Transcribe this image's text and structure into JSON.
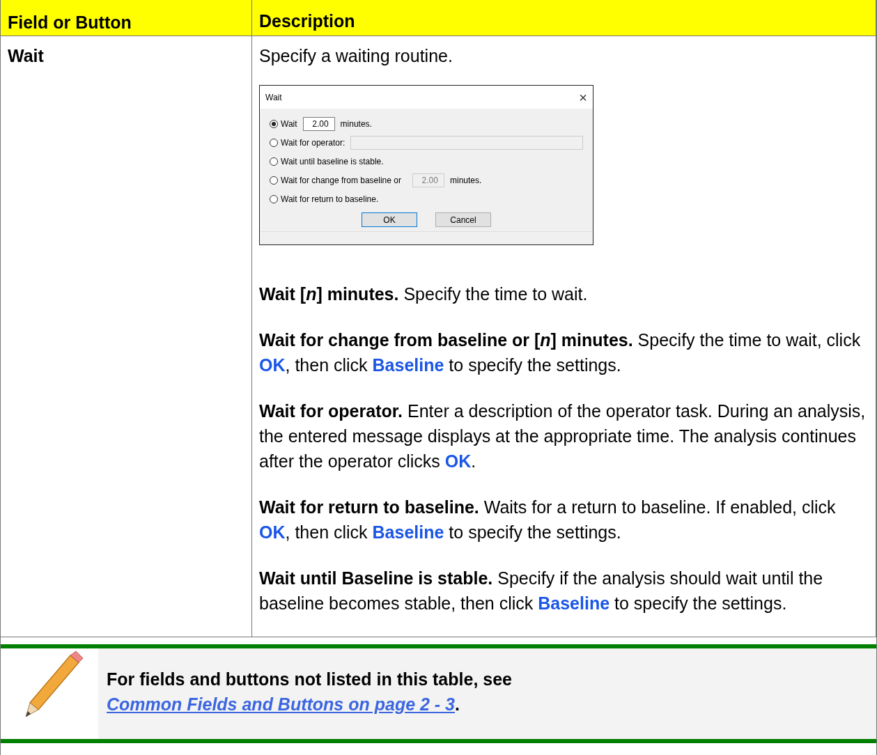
{
  "table": {
    "columns": [
      "Field or Button",
      "Description"
    ],
    "rows": [
      {
        "field": "Wait",
        "intro": "Specify a waiting routine.",
        "dialog": {
          "title": "Wait",
          "close": "×",
          "options": [
            {
              "label": "Wait",
              "selected": true,
              "field": {
                "value": "2.00",
                "disabled": false
              },
              "suffix": "minutes."
            },
            {
              "label": "Wait for operator:",
              "selected": false,
              "field": {
                "disabled": true
              }
            },
            {
              "label": "Wait until baseline is stable.",
              "selected": false
            },
            {
              "label": "Wait for change from baseline or",
              "selected": false,
              "field": {
                "value": "2.00",
                "disabled": true
              },
              "suffix": "minutes."
            },
            {
              "label": "Wait for return to baseline.",
              "selected": false
            }
          ],
          "buttons": [
            {
              "label": "OK",
              "default": true
            },
            {
              "label": "Cancel",
              "default": false
            }
          ]
        },
        "paragraphs": [
          {
            "lead": "Wait [*n*] minutes.",
            "text": "Specify the time to wait."
          },
          {
            "lead": "Wait for change from baseline or [*n*] minutes.",
            "text": "Specify the time to wait, click **OK**, then click **Baseline** to specify the settings."
          },
          {
            "lead": "Wait for operator.",
            "text": "Enter a description of the operator task. During an analysis, the entered message displays at the appropriate time. The analysis continues after the operator clicks **OK**."
          },
          {
            "lead": "Wait for return to baseline.",
            "text": "Waits for a return to baseline. If enabled, click **OK**, then click **Baseline**  to specify the settings."
          },
          {
            "lead": "Wait until Baseline is stable.",
            "text": "Specify if the analysis should wait until the baseline becomes stable, then click **Baseline**  to specify the settings."
          }
        ]
      }
    ]
  },
  "note": {
    "text": "For fields and buttons not listed in this table, see",
    "link": "Common Fields and Buttons on page 2 - 3",
    "end": "."
  }
}
